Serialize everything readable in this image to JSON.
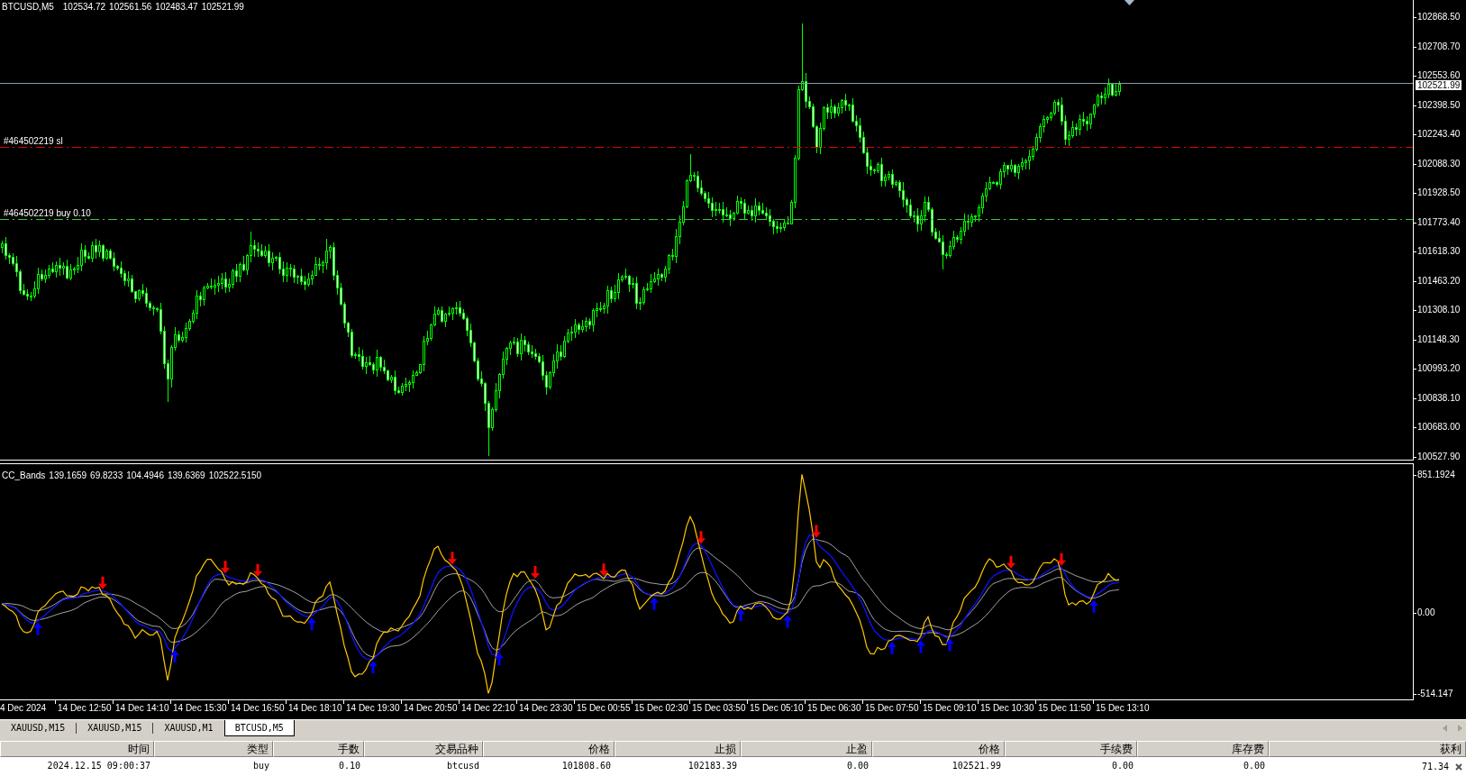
{
  "chart": {
    "symbol": "BTCUSD,M5",
    "ohlc": [
      "102534.72",
      "102561.56",
      "102483.47",
      "102521.99"
    ],
    "order_lines": [
      {
        "kind": "sl",
        "label": "#464502219 sl"
      },
      {
        "kind": "entry",
        "label": "#464502219 buy 0.10"
      }
    ],
    "price_axis": [
      "102868.50",
      "102708.70",
      "102553.60",
      "102398.50",
      "102243.40",
      "102088.30",
      "101928.50",
      "101773.40",
      "101618.30",
      "101463.20",
      "101308.10",
      "101148.30",
      "100993.20",
      "100838.10",
      "100683.00",
      "100527.90"
    ],
    "current_price": "102521.99"
  },
  "indicator": {
    "name": "CC_Bands",
    "values": [
      "139.1659",
      "69.8233",
      "104.4946",
      "139.6369",
      "102522.5150"
    ],
    "axis": [
      "851.1924",
      "0.00",
      "-514.147"
    ]
  },
  "time_axis": [
    "4 Dec 2024",
    "14 Dec 12:50",
    "14 Dec 14:10",
    "14 Dec 15:30",
    "14 Dec 16:50",
    "14 Dec 18:10",
    "14 Dec 19:30",
    "14 Dec 20:50",
    "14 Dec 22:10",
    "14 Dec 23:30",
    "15 Dec 00:55",
    "15 Dec 02:30",
    "15 Dec 03:50",
    "15 Dec 05:10",
    "15 Dec 06:30",
    "15 Dec 07:50",
    "15 Dec 09:10",
    "15 Dec 10:30",
    "15 Dec 11:50",
    "15 Dec 13:10"
  ],
  "tabs": [
    {
      "label": "XAUUSD,M15",
      "selected": false
    },
    {
      "label": "XAUUSD,M15",
      "selected": false
    },
    {
      "label": "XAUUSD,M1",
      "selected": false
    },
    {
      "label": "BTCUSD,M5",
      "selected": true
    }
  ],
  "table": {
    "columns": [
      "时间",
      "类型",
      "手数",
      "交易品种",
      "价格",
      "止损",
      "止盈",
      "价格",
      "手续费",
      "库存费",
      "获利"
    ],
    "rows": [
      {
        "cells": [
          "2024.12.15 09:00:37",
          "buy",
          "0.10",
          "btcusd",
          "101808.60",
          "102183.39",
          "0.00",
          "102521.99",
          "0.00",
          "0.00",
          "71.34"
        ]
      }
    ]
  }
}
